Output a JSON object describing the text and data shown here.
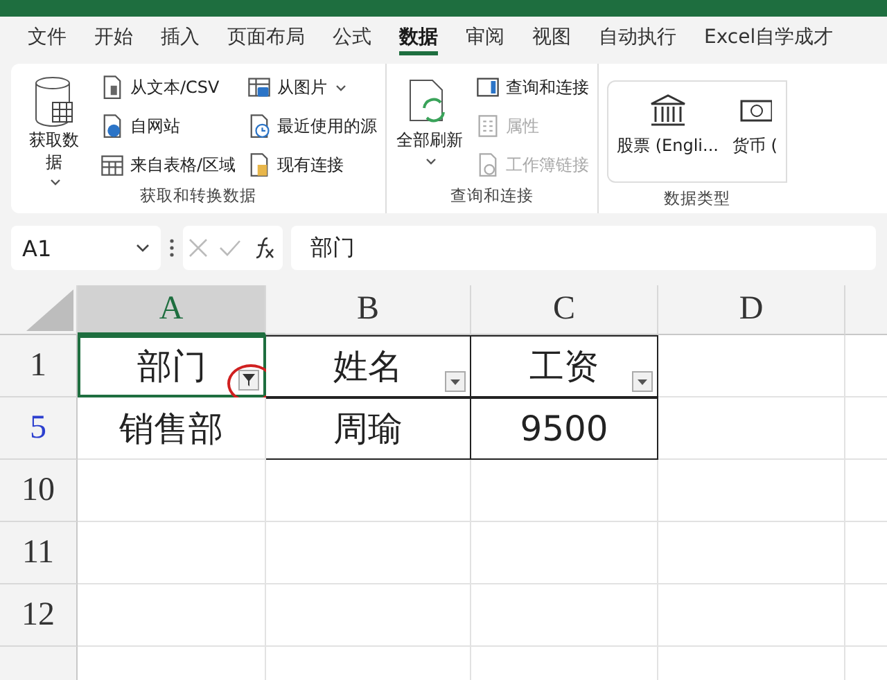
{
  "tabs": [
    {
      "label": "文件",
      "selected": false
    },
    {
      "label": "开始",
      "selected": false
    },
    {
      "label": "插入",
      "selected": false
    },
    {
      "label": "页面布局",
      "selected": false
    },
    {
      "label": "公式",
      "selected": false
    },
    {
      "label": "数据",
      "selected": true
    },
    {
      "label": "审阅",
      "selected": false
    },
    {
      "label": "视图",
      "selected": false
    },
    {
      "label": "自动执行",
      "selected": false
    },
    {
      "label": "Excel自学成才",
      "selected": false
    }
  ],
  "ribbon": {
    "groups": [
      {
        "label": "获取和转换数据",
        "big_button": {
          "label": "获取数据",
          "dropdown": true
        },
        "columns": [
          [
            {
              "label": "从文本/CSV",
              "dropdown": false,
              "disabled": false
            },
            {
              "label": "自网站",
              "dropdown": false,
              "disabled": false
            },
            {
              "label": "来自表格/区域",
              "dropdown": false,
              "disabled": false
            }
          ],
          [
            {
              "label": "从图片",
              "dropdown": true,
              "disabled": false
            },
            {
              "label": "最近使用的源",
              "dropdown": false,
              "disabled": false
            },
            {
              "label": "现有连接",
              "dropdown": false,
              "disabled": false
            }
          ]
        ]
      },
      {
        "label": "查询和连接",
        "big_button": {
          "label": "全部刷新",
          "dropdown": true
        },
        "columns": [
          [
            {
              "label": "查询和连接",
              "dropdown": false,
              "disabled": false
            },
            {
              "label": "属性",
              "dropdown": false,
              "disabled": true
            },
            {
              "label": "工作簿链接",
              "dropdown": false,
              "disabled": true
            }
          ]
        ]
      },
      {
        "label": "数据类型",
        "types": [
          {
            "label": "股票 (Engli..."
          },
          {
            "label": "货币 ("
          }
        ]
      }
    ]
  },
  "formula_bar": {
    "name_box": "A1",
    "formula": "部门"
  },
  "sheet": {
    "columns": [
      {
        "label": "A",
        "selected": true
      },
      {
        "label": "B",
        "selected": false
      },
      {
        "label": "C",
        "selected": false
      },
      {
        "label": "D",
        "selected": false
      },
      {
        "selected": false
      }
    ],
    "header_row": {
      "label": "1",
      "filtered": false,
      "cells": [
        {
          "value": "部门",
          "filtered": true,
          "circled": true
        },
        {
          "value": "姓名",
          "filtered": false,
          "circled": false
        },
        {
          "value": "工资",
          "filtered": false,
          "circled": false
        }
      ]
    },
    "rows": [
      {
        "label": "5",
        "filtered": true,
        "cells": [
          "销售部",
          "周瑜",
          "9500"
        ]
      },
      {
        "label": "10",
        "filtered": false,
        "cells": []
      },
      {
        "label": "11",
        "filtered": false,
        "cells": []
      },
      {
        "label": "12",
        "filtered": false,
        "cells": []
      },
      {
        "cells": []
      }
    ]
  }
}
